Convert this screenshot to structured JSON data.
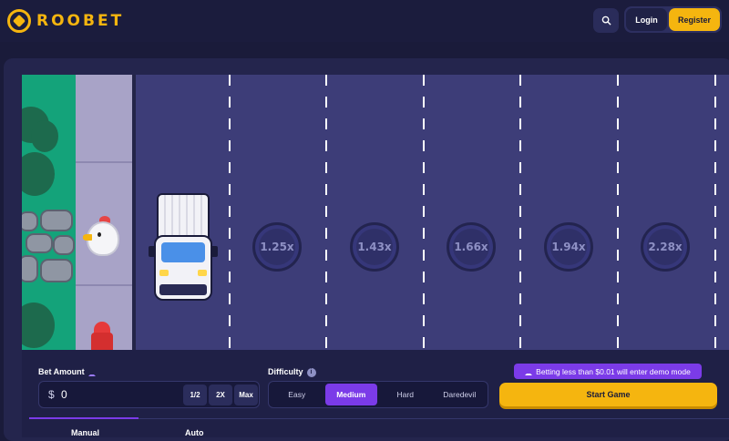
{
  "header": {
    "logo_text": "ROOBET",
    "search_icon": "search-icon",
    "login_label": "Login",
    "register_label": "Register"
  },
  "game": {
    "multipliers": [
      "1.25x",
      "1.43x",
      "1.66x",
      "1.94x",
      "2.28x"
    ]
  },
  "controls": {
    "bet_label": "Bet Amount",
    "currency_symbol": "$",
    "bet_value": "0",
    "half_label": "1/2",
    "double_label": "2X",
    "max_label": "Max",
    "difficulty_label": "Difficulty",
    "difficulties": [
      "Easy",
      "Medium",
      "Hard",
      "Daredevil"
    ],
    "selected_difficulty": "Medium",
    "demo_notice": "Betting less than $0.01 will enter demo mode",
    "start_label": "Start Game",
    "tabs": [
      "Manual",
      "Auto"
    ]
  },
  "colors": {
    "accent": "#f5b50f",
    "purple": "#7b3be8",
    "background": "#1a1b3a"
  }
}
